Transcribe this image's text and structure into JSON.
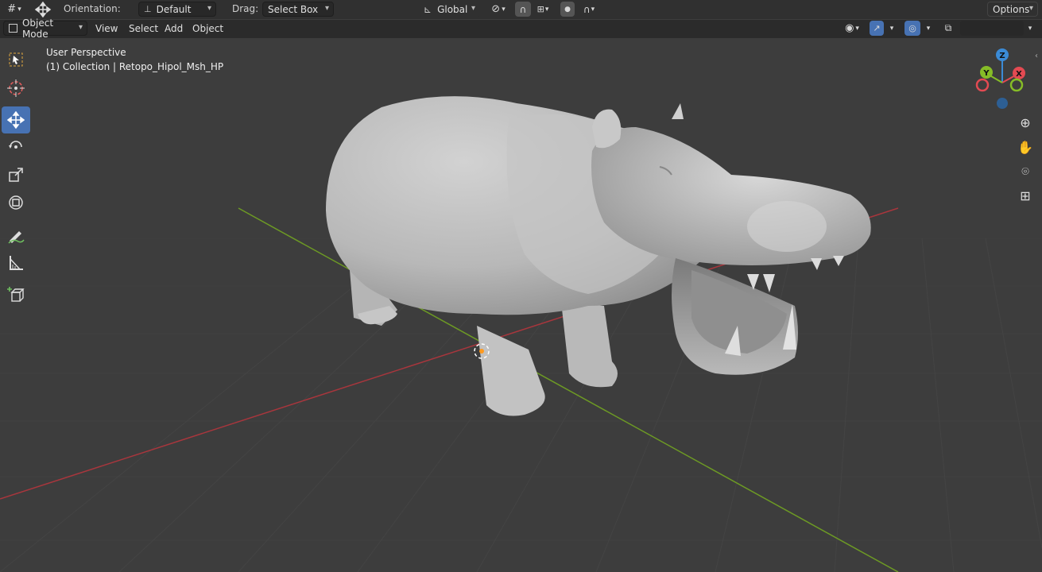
{
  "topbar": {
    "orientation_label": "Orientation:",
    "orientation_value": "Default",
    "drag_label": "Drag:",
    "drag_value": "Select Box",
    "transform_value": "Global",
    "options_label": "Options"
  },
  "header": {
    "mode_value": "Object Mode",
    "menus": [
      "View",
      "Select",
      "Add",
      "Object"
    ]
  },
  "viewport": {
    "perspective_label": "User Perspective",
    "collection_label": "(1) Collection | Retopo_Hipol_Msh_HP"
  },
  "gizmo": {
    "z_label": "Z",
    "y_label": "Y",
    "x_label": "X"
  },
  "icons": {
    "toolbar": [
      "select-box-icon",
      "cursor-icon",
      "move-icon",
      "rotate-icon",
      "scale-icon",
      "transform-icon",
      "annotate-icon",
      "measure-icon",
      "add-cube-icon"
    ],
    "nav": [
      "zoom-icon",
      "hand-pan-icon",
      "camera-icon",
      "grid-ortho-icon"
    ]
  },
  "colors": {
    "active_tool": "#4772b3",
    "axis_x": "#e34a52",
    "axis_y": "#86bc27",
    "axis_z": "#3b8bd6"
  }
}
